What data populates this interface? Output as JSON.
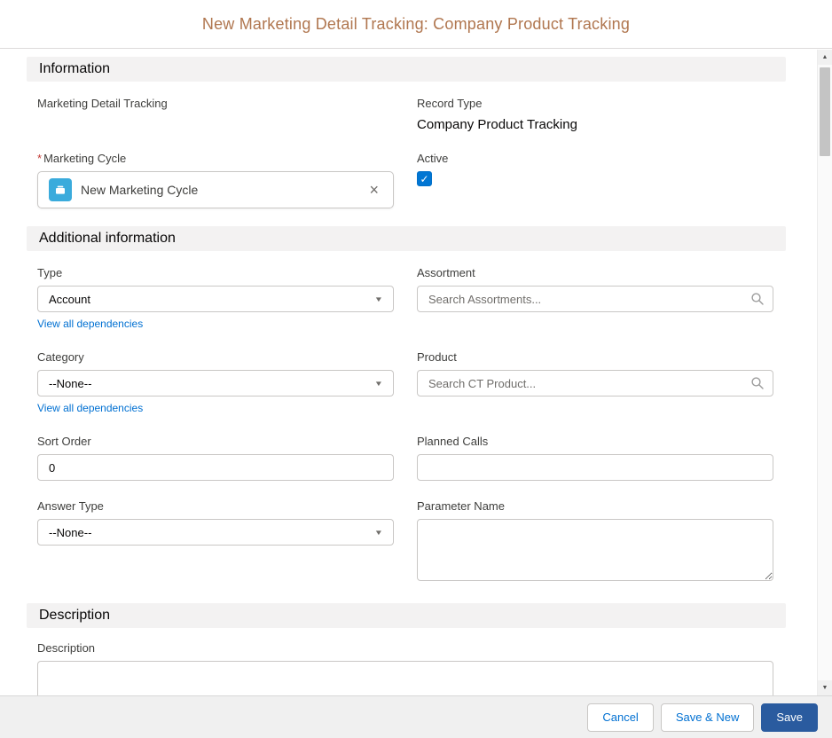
{
  "modal": {
    "title": "New Marketing Detail Tracking: Company Product Tracking"
  },
  "sections": {
    "information": {
      "title": "Information"
    },
    "additional": {
      "title": "Additional information"
    },
    "description": {
      "title": "Description"
    }
  },
  "fields": {
    "marketing_detail_tracking": {
      "label": "Marketing Detail Tracking"
    },
    "record_type": {
      "label": "Record Type",
      "value": "Company Product Tracking"
    },
    "marketing_cycle": {
      "label": "Marketing Cycle",
      "required_mark": "*",
      "value": "New Marketing Cycle"
    },
    "active": {
      "label": "Active",
      "checked": true
    },
    "type": {
      "label": "Type",
      "value": "Account",
      "dependency_link": "View all dependencies"
    },
    "assortment": {
      "label": "Assortment",
      "placeholder": "Search Assortments...",
      "value": ""
    },
    "category": {
      "label": "Category",
      "value": "--None--",
      "dependency_link": "View all dependencies"
    },
    "product": {
      "label": "Product",
      "placeholder": "Search CT Product...",
      "value": ""
    },
    "sort_order": {
      "label": "Sort Order",
      "value": "0"
    },
    "planned_calls": {
      "label": "Planned Calls",
      "value": ""
    },
    "answer_type": {
      "label": "Answer Type",
      "value": "--None--"
    },
    "parameter_name": {
      "label": "Parameter Name",
      "value": ""
    },
    "description": {
      "label": "Description",
      "value": ""
    }
  },
  "footer": {
    "cancel_label": "Cancel",
    "save_new_label": "Save & New",
    "save_label": "Save"
  },
  "icons": {
    "close": "×",
    "check": "✓",
    "dropdown_arrow": "▼",
    "scroll_up": "▲",
    "scroll_down": "▼"
  },
  "colors": {
    "title_text": "#b0764f",
    "link": "#0070d2",
    "checkbox_checked": "#0176d3",
    "save_button_bg": "#2a5b9f",
    "section_header_bg": "#f3f2f2",
    "lookup_icon_bg": "#3aabdc",
    "required_mark": "#c23934"
  }
}
